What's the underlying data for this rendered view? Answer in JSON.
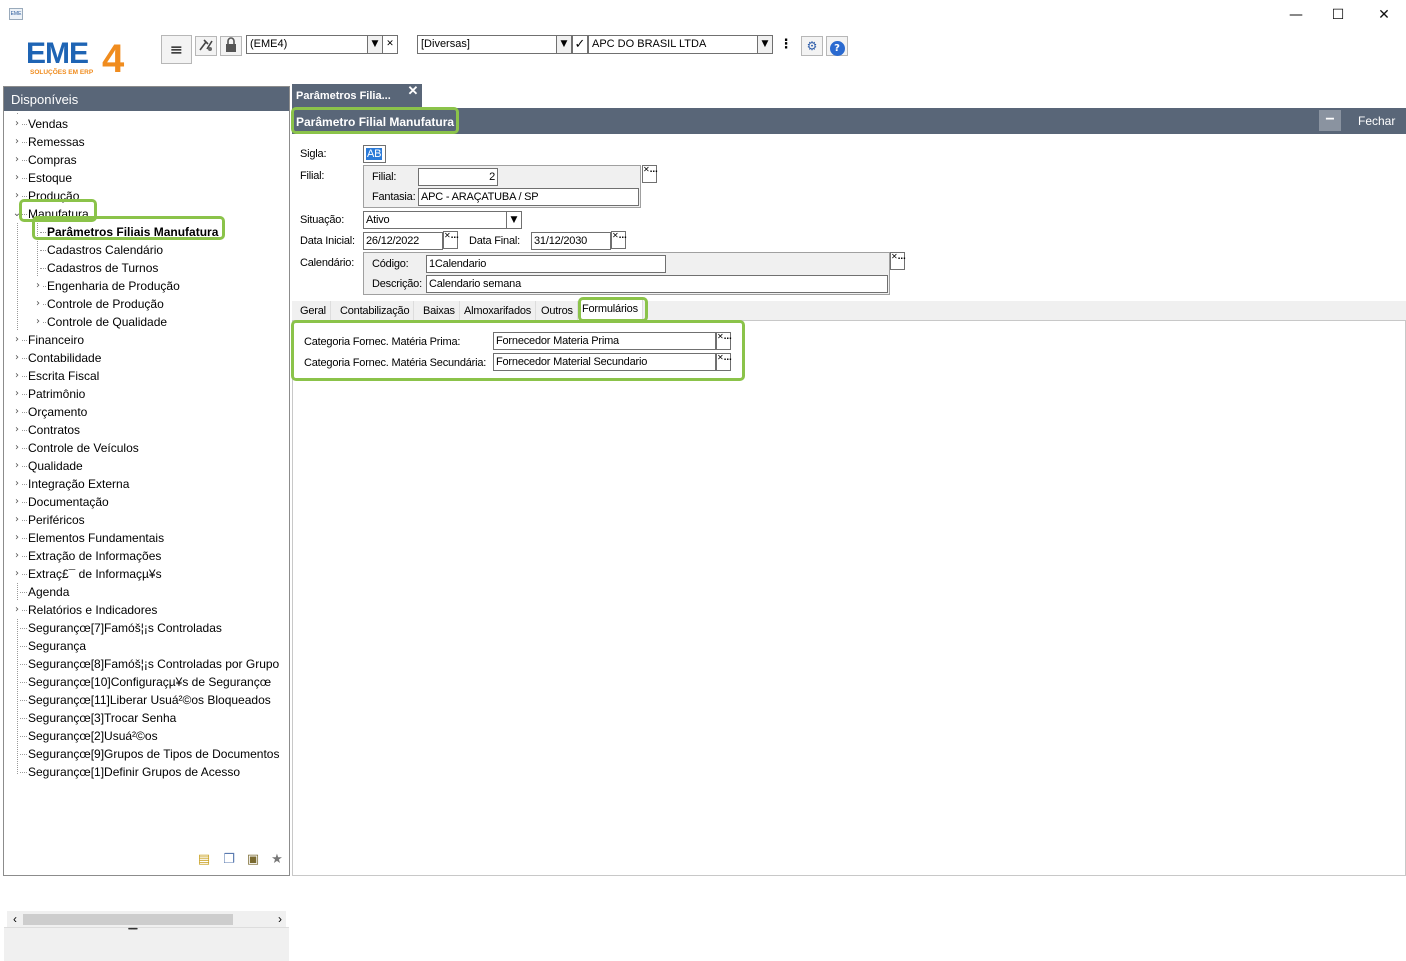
{
  "window": {
    "minimize": "—",
    "maximize": "☐",
    "close": "✕",
    "icon": "EME4 app icon"
  },
  "logo": {
    "brand": "EME4",
    "tagline": "SOLUÇÕES EM ERP",
    "colors": {
      "blue": "#1e64b4",
      "orange": "#f08c1e"
    }
  },
  "toolbar": {
    "menu_icon": "≡",
    "tools_icon": "⚙",
    "lock_icon": "🔒",
    "company_combo": "(EME4)",
    "group_combo": "[Diversas]",
    "check_icon": "✓",
    "branch_combo": "APC DO BRASIL LTDA",
    "more_icon": "⋮",
    "settings_icon": "⚙",
    "help_icon": "?",
    "clear_icon": "✕",
    "dropdown_icon": "▼"
  },
  "left": {
    "header": "Disponíveis",
    "items": [
      "Vendas",
      "Remessas",
      "Compras",
      "Estoque",
      "Produção",
      "Manufatura",
      "Parâmetros Filiais Manufatura",
      "Cadastros Calendário",
      "Cadastros de Turnos",
      "Engenharia de Produção",
      "Controle de Produção",
      "Controle de Qualidade",
      "Financeiro",
      "Contabilidade",
      "Escrita Fiscal",
      "Patrimônio",
      "Orçamento",
      "Contratos",
      "Controle de Veículos",
      "Qualidade",
      "Integração Externa",
      "Documentação",
      "Periféricos",
      "Elementos Fundamentais",
      "Extração de Informações",
      "Extraç£¯ de Informaçµ¥s",
      "Agenda",
      "Relatórios e Indicadores",
      "Segurançœ[7]Famóš¦¡s Controladas",
      "Segurança",
      "Segurançœ[8]Famóš¦¡s Controladas por Grupo",
      "Segurançœ[10]Configuraçµ¥s de Segurançœ",
      "Segurançœ[11]Liberar Usuá²©os Bloqueados",
      "Segurançœ[3]Trocar Senha",
      "Segurançœ[2]Usuá²©os",
      "Segurançœ[9]Grupos de Tipos de Documentos",
      "Segurançœ[1]Definir Grupos de Acesso"
    ],
    "expander": "›",
    "expander_open": "⌄",
    "scroll_left": "‹",
    "scroll_right": "›",
    "grip": "••••••••"
  },
  "form": {
    "tab_title": "Parâmetros Filia...",
    "tab_close": "✕",
    "title": "Parâmetro Filial Manufatura",
    "close_label": "Fechar",
    "collapse_icon": "−",
    "sigla_label": "Sigla:",
    "sigla": "AB",
    "filial_label": "Filial:",
    "filial_inner_label": "Filial:",
    "filial": "2",
    "fantasia_label": "Fantasia:",
    "fantasia": "APC - ARAÇATUBA / SP",
    "situacao_label": "Situação:",
    "situacao": "Ativo",
    "data_inicial_label": "Data Inicial:",
    "data_inicial": "26/12/2022",
    "data_final_label": "Data Final:",
    "data_final": "31/12/2030",
    "calendario_label": "Calendário:",
    "codigo_label": "Código:",
    "codigo": "1Calendario",
    "descricao_label": "Descrição:",
    "descricao": "Calendario semana",
    "lookup_icon": "✕…",
    "tabs": [
      "Geral",
      "Contabilização",
      "Baixas",
      "Almoxarifados",
      "Outros",
      "Formulários"
    ],
    "cat_prima_label": "Categoria Fornec. Matéria Prima:",
    "cat_prima": "Fornecedor Materia Prima",
    "cat_sec_label": "Categoria Fornec. Matéria Secundária:",
    "cat_sec": "Fornecedor Material Secundario"
  },
  "accent": "#8bc34a",
  "header_color": "#596678"
}
